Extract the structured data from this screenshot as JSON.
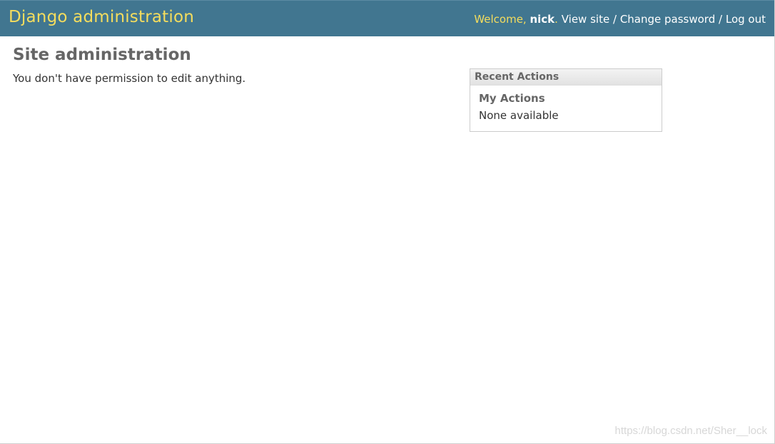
{
  "header": {
    "site_name": "Django administration",
    "welcome_prefix": "Welcome, ",
    "username": "nick",
    "username_suffix": ".",
    "view_site": "View site",
    "separator": "/",
    "change_password": "Change password",
    "log_out": "Log out"
  },
  "content": {
    "title": "Site administration",
    "permission_message": "You don't have permission to edit anything."
  },
  "recent_actions": {
    "title": "Recent Actions",
    "my_actions_title": "My Actions",
    "empty_text": "None available"
  },
  "watermark": {
    "text": "https://blog.csdn.net/Sher__lock"
  },
  "colors": {
    "header_bg": "#417690",
    "brand_text": "#f5dd5d",
    "heading_text": "#666666"
  }
}
